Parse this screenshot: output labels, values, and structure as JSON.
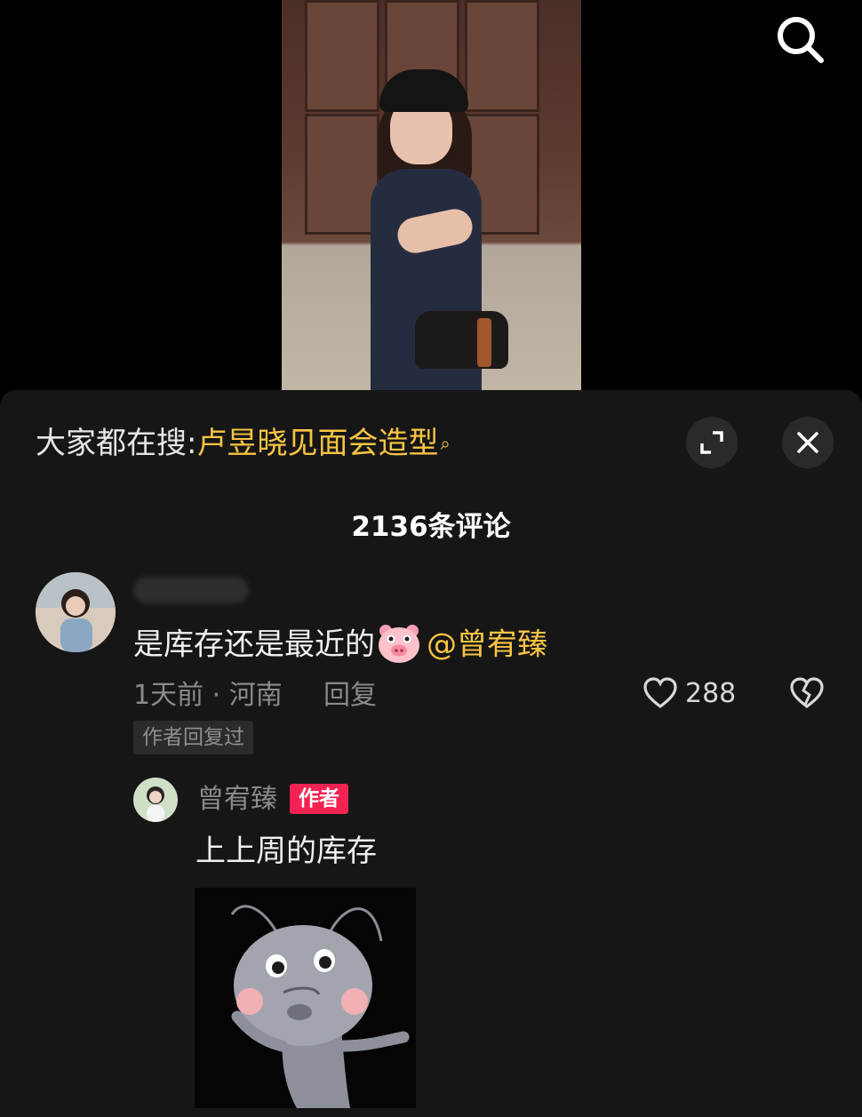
{
  "video": {
    "description_icon": "video-frame"
  },
  "top_bar": {
    "search_icon": "search-icon"
  },
  "trending": {
    "prefix": "大家都在搜:",
    "keyword": "卢昱晓见面会造型",
    "search_glyph": "⌕",
    "accent_color": "#f8c443"
  },
  "panel_controls": {
    "expand_icon": "expand-icon",
    "close_icon": "close-icon"
  },
  "comments_header": {
    "count_label": "2136条评论"
  },
  "comment": {
    "text": "是库存还是最近的",
    "mention": "@曾宥臻",
    "time_location": "1天前 · 河南",
    "reply_label": "回复",
    "like_count": "288",
    "replied_tag": "作者回复过"
  },
  "reply": {
    "username": "曾宥臻",
    "author_badge": "作者",
    "badge_color": "#f22352",
    "text": "上上周的库存"
  }
}
